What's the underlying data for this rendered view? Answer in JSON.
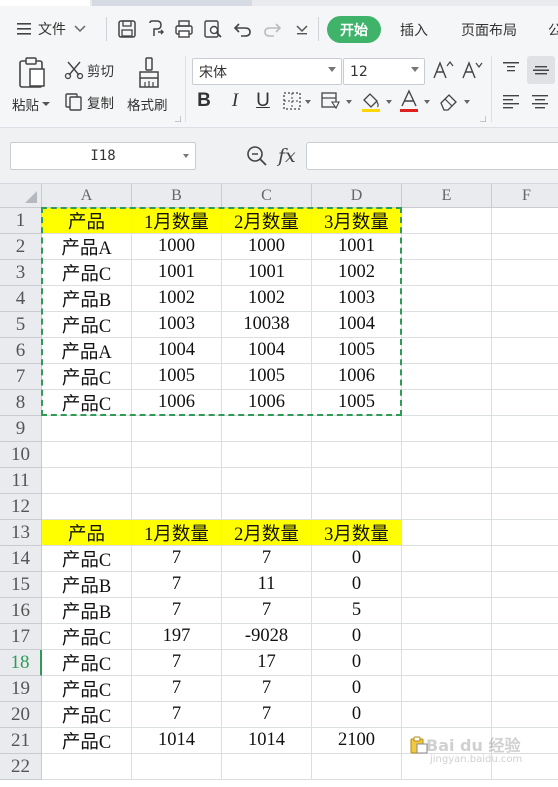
{
  "menu": {
    "file_label": "文件",
    "tabs": [
      "开始",
      "插入",
      "页面布局",
      "公"
    ]
  },
  "ribbon": {
    "paste": "粘贴",
    "cut": "剪切",
    "copy": "复制",
    "format_painter": "格式刷",
    "font_name": "宋体",
    "font_size": "12",
    "bold": "B",
    "italic": "I",
    "underline": "U"
  },
  "formula_bar": {
    "name_box": "I18",
    "fx": "fx",
    "formula": ""
  },
  "sheet": {
    "columns": [
      "A",
      "B",
      "C",
      "D",
      "E",
      "F"
    ],
    "rows": [
      "1",
      "2",
      "3",
      "4",
      "5",
      "6",
      "7",
      "8",
      "9",
      "10",
      "11",
      "12",
      "13",
      "14",
      "15",
      "16",
      "17",
      "18",
      "19",
      "20",
      "21",
      "22"
    ],
    "active_row": "18",
    "data": [
      [
        "产品",
        "1月数量",
        "2月数量",
        "3月数量"
      ],
      [
        "产品A",
        "1000",
        "1000",
        "1001"
      ],
      [
        "产品C",
        "1001",
        "1001",
        "1002"
      ],
      [
        "产品B",
        "1002",
        "1002",
        "1003"
      ],
      [
        "产品C",
        "1003",
        "10038",
        "1004"
      ],
      [
        "产品A",
        "1004",
        "1004",
        "1005"
      ],
      [
        "产品C",
        "1005",
        "1005",
        "1006"
      ],
      [
        "产品C",
        "1006",
        "1006",
        "1005"
      ],
      [
        "",
        "",
        "",
        ""
      ],
      [
        "",
        "",
        "",
        ""
      ],
      [
        "",
        "",
        "",
        ""
      ],
      [
        "",
        "",
        "",
        ""
      ],
      [
        "产品",
        "1月数量",
        "2月数量",
        "3月数量"
      ],
      [
        "产品C",
        "7",
        "7",
        "0"
      ],
      [
        "产品B",
        "7",
        "11",
        "0"
      ],
      [
        "产品B",
        "7",
        "7",
        "5"
      ],
      [
        "产品C",
        "197",
        "-9028",
        "0"
      ],
      [
        "产品C",
        "7",
        "17",
        "0"
      ],
      [
        "产品C",
        "7",
        "7",
        "0"
      ],
      [
        "产品C",
        "7",
        "7",
        "0"
      ],
      [
        "产品C",
        "1014",
        "1014",
        "2100"
      ],
      [
        "",
        "",
        "",
        ""
      ]
    ],
    "highlight_color": "#ffff00",
    "selection_color": "#2f9b56"
  },
  "watermark": {
    "text": "Bai du 经验",
    "url": "jingyan.baidu.com"
  }
}
